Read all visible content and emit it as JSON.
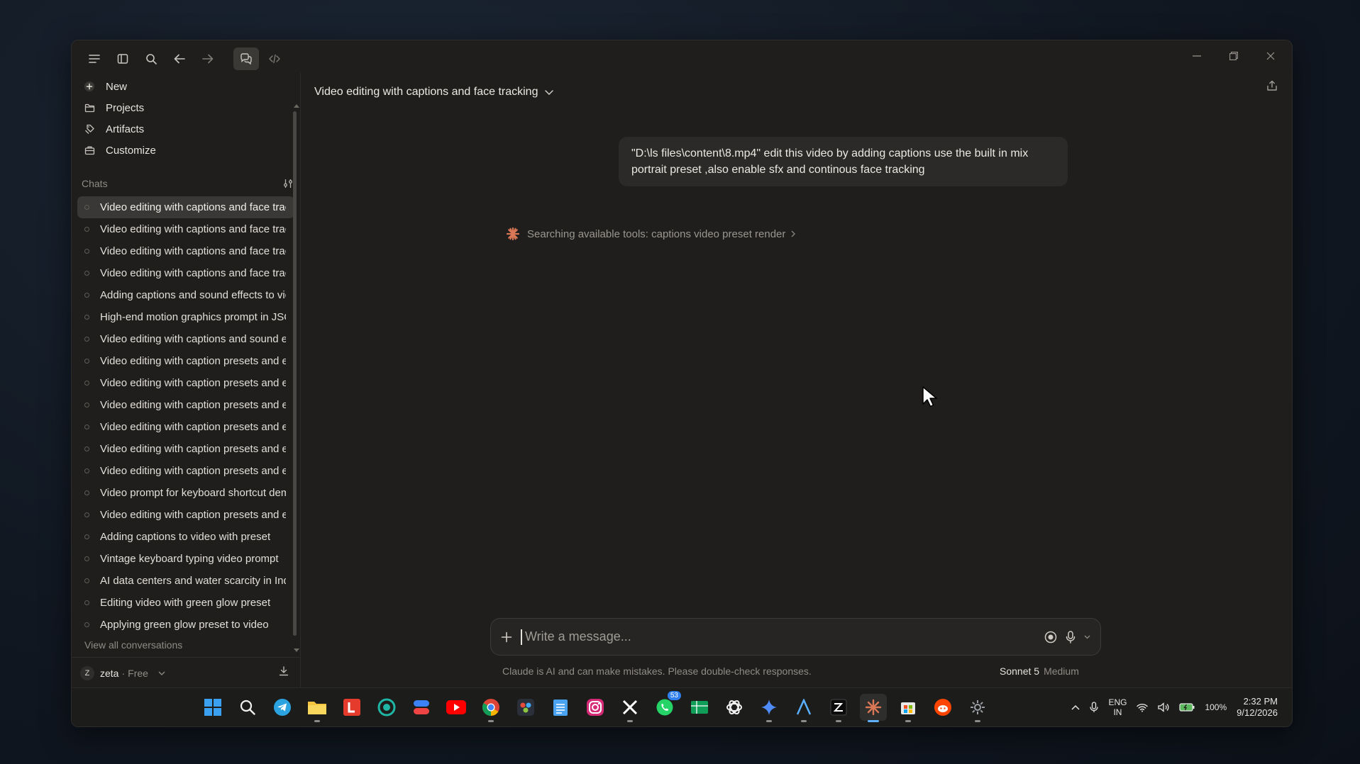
{
  "app": {
    "toolbar": {
      "chat_icon": "chat-bubbles-icon",
      "code_icon": "code-icon"
    }
  },
  "sidebar": {
    "nav": [
      {
        "label": "New",
        "icon": "plus-circle-icon"
      },
      {
        "label": "Projects",
        "icon": "folder-icon"
      },
      {
        "label": "Artifacts",
        "icon": "artifacts-icon"
      },
      {
        "label": "Customize",
        "icon": "toolbox-icon"
      }
    ],
    "chats_label": "Chats",
    "chats": [
      "Video editing with captions and face tracking",
      "Video editing with captions and face tracking",
      "Video editing with captions and face tracking",
      "Video editing with captions and face tracking",
      "Adding captions and sound effects to video",
      "High-end motion graphics prompt in JSON",
      "Video editing with captions and sound effects",
      "Video editing with caption presets and effects",
      "Video editing with caption presets and effects",
      "Video editing with caption presets and effects",
      "Video editing with caption presets and effects",
      "Video editing with caption presets and effects",
      "Video editing with caption presets and effects",
      "Video prompt for keyboard shortcut demo",
      "Video editing with caption presets and effects",
      "Adding captions to video with preset",
      "Vintage keyboard typing video prompt",
      "AI data centers and water scarcity in India",
      "Editing video with green glow preset",
      "Applying green glow preset to video"
    ],
    "view_all": "View all conversations",
    "user": {
      "initial": "Z",
      "name": "zeta",
      "separator": "·",
      "plan": "Free"
    }
  },
  "conversation": {
    "title": "Video editing with captions and face tracking",
    "user_message": "\"D:\\ls files\\content\\8.mp4\" edit this video by adding captions use the built in mix portrait preset ,also enable sfx and continous face tracking",
    "status": "Searching available tools: captions video preset render"
  },
  "composer": {
    "placeholder": "Write a message...",
    "disclaimer": "Claude is AI and can make mistakes. Please double-check responses.",
    "model": "Sonnet 5",
    "effort": "Medium"
  },
  "taskbar": {
    "whatsapp_badge": "53",
    "lang_line1": "ENG",
    "lang_line2": "IN",
    "battery": "100%",
    "time": "2:32 PM",
    "date": "9/12/2026"
  },
  "colors": {
    "accent": "#d97757",
    "window_bg": "#1f1e1d",
    "active_chat": "#393836"
  }
}
